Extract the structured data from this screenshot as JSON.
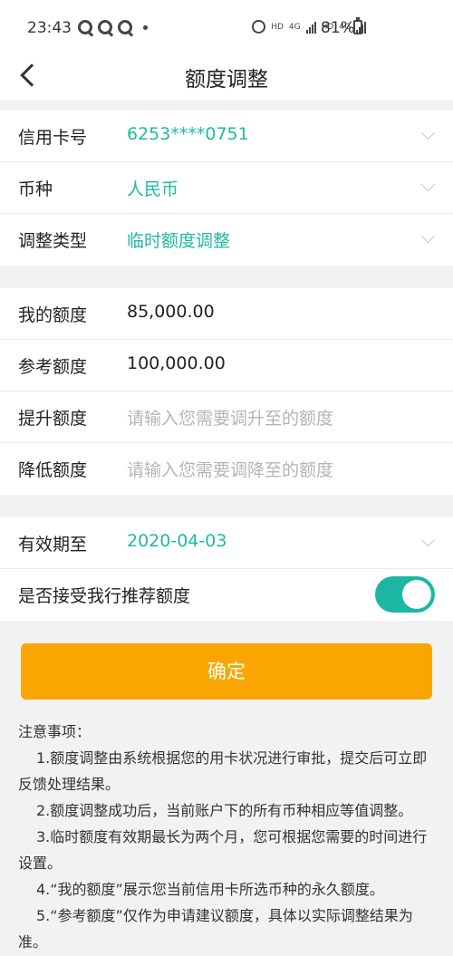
{
  "status": {
    "time": "23:43",
    "net1": "HD",
    "net2": "4G",
    "net3": "HD",
    "net4": "4G",
    "battery": "81%"
  },
  "nav": {
    "title": "额度调整"
  },
  "card1": {
    "card_label": "信用卡号",
    "card_value": "6253****0751",
    "currency_label": "币种",
    "currency_value": "人民币",
    "type_label": "调整类型",
    "type_value": "临时额度调整"
  },
  "card2": {
    "my_label": "我的额度",
    "my_value": "85,000.00",
    "ref_label": "参考额度",
    "ref_value": "100,000.00",
    "raise_label": "提升额度",
    "raise_placeholder": "请输入您需要调升至的额度",
    "lower_label": "降低额度",
    "lower_placeholder": "请输入您需要调降至的额度"
  },
  "card3": {
    "valid_label": "有效期至",
    "valid_value": "2020-04-03",
    "accept_label": "是否接受我行推荐额度",
    "accept_on": true
  },
  "confirm_label": "确定",
  "notes": {
    "title": "注意事项：",
    "items": [
      "1.额度调整由系统根据您的用卡状况进行审批，提交后可立即反馈处理结果。",
      "2.额度调整成功后，当前账户下的所有币种相应等值调整。",
      "3.临时额度有效期最长为两个月，您可根据您需要的时间进行设置。",
      "4.“我的额度”展示您当前信用卡所选币种的永久额度。",
      "5.“参考额度”仅作为申请建议额度，具体以实际调整结果为准。"
    ]
  },
  "colors": {
    "accent": "#1fb9a5",
    "button": "#f9a602",
    "toggle": "#1cb7a3"
  }
}
